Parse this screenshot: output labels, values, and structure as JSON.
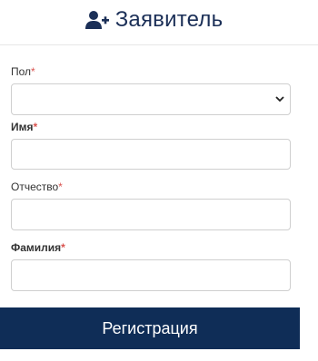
{
  "header": {
    "title": "Заявитель",
    "icon": "user-plus-icon"
  },
  "form": {
    "gender": {
      "label": "Пол",
      "required_mark": "*",
      "value": ""
    },
    "first_name": {
      "label": "Имя",
      "required_mark": "*",
      "value": ""
    },
    "patronymic": {
      "label": "Отчество",
      "required_mark": "*",
      "value": ""
    },
    "last_name": {
      "label": "Фамилия",
      "required_mark": "*",
      "value": ""
    }
  },
  "submit": {
    "label": "Регистрация"
  },
  "colors": {
    "brand": "#0f2d57",
    "title": "#1b2f57",
    "required": "#d9534f"
  }
}
